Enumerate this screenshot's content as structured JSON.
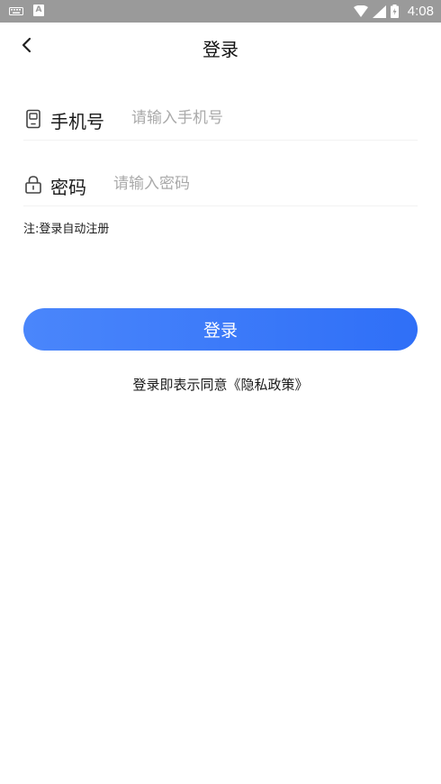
{
  "status_bar": {
    "time": "4:08",
    "input_method_badge": "A",
    "icons": [
      "keyboard-icon",
      "input-method-icon",
      "wifi-icon",
      "signal-icon",
      "battery-icon"
    ]
  },
  "header": {
    "title": "登录",
    "back_icon": "chevron-left-icon"
  },
  "form": {
    "phone": {
      "icon": "phone-icon",
      "label": "手机号",
      "placeholder": "请输入手机号",
      "value": ""
    },
    "password": {
      "icon": "lock-icon",
      "label": "密码",
      "placeholder": "请输入密码",
      "value": ""
    },
    "note": "注:登录自动注册"
  },
  "login_button": {
    "label": "登录"
  },
  "agreement": {
    "text": "登录即表示同意",
    "link": "《隐私政策》"
  },
  "colors": {
    "status_bar": "#9a9a9a",
    "button_start": "#4a86fb",
    "button_end": "#2f6ff7",
    "placeholder": "#aaaaaa"
  }
}
